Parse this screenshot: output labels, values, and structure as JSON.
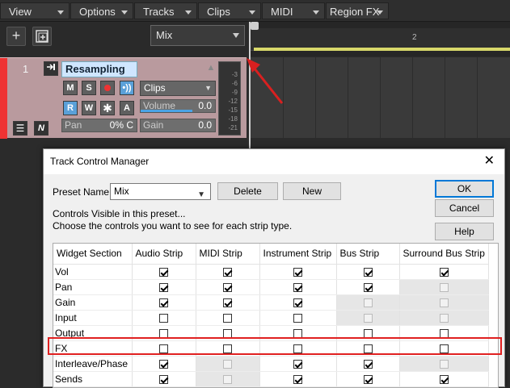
{
  "menubar": {
    "items": [
      "View",
      "Options",
      "Tracks",
      "Clips",
      "MIDI",
      "Region FX"
    ]
  },
  "toolbar": {
    "add_icon": "plus-icon",
    "add_group_icon": "add-group-icon",
    "preset_value": "Mix"
  },
  "ruler": {
    "marker": "2"
  },
  "track": {
    "number": "1",
    "name": "Resampling",
    "buttons": {
      "mute": "M",
      "solo": "S",
      "read": "R",
      "write": "W",
      "automation": "A"
    },
    "clips_dropdown": "Clips",
    "volume_label": "Volume",
    "volume_value": "0.0",
    "volume_level": 0.7,
    "pan_label": "Pan",
    "pan_value": "0% C",
    "gain_label": "Gain",
    "gain_value": "0.0",
    "meter_ticks": [
      "-3",
      "-6",
      "-9",
      "-12",
      "-15",
      "-18",
      "-21"
    ]
  },
  "colors": {
    "track_stripe": "#e33333",
    "highlight": "#e02020",
    "accent": "#0078d7"
  },
  "dialog": {
    "title": "Track Control Manager",
    "preset_label": "Preset Name:",
    "preset_value": "Mix",
    "delete_label": "Delete",
    "new_label": "New",
    "ok_label": "OK",
    "cancel_label": "Cancel",
    "help_label": "Help",
    "info_line1": "Controls Visible in this preset...",
    "info_line2": "Choose the controls you want to see for each strip type.",
    "columns": [
      "Widget Section",
      "Audio Strip",
      "MIDI Strip",
      "Instrument Strip",
      "Bus Strip",
      "Surround Bus Strip"
    ],
    "rows": [
      {
        "name": "Vol",
        "cells": [
          "on",
          "on",
          "on",
          "on",
          "on"
        ]
      },
      {
        "name": "Pan",
        "cells": [
          "on",
          "on",
          "on",
          "on",
          "dis"
        ]
      },
      {
        "name": "Gain",
        "cells": [
          "on",
          "on",
          "on",
          "dis",
          "dis"
        ]
      },
      {
        "name": "Input",
        "cells": [
          "off",
          "off",
          "off",
          "dis",
          "dis"
        ]
      },
      {
        "name": "Output",
        "cells": [
          "off",
          "off",
          "off",
          "off",
          "off"
        ]
      },
      {
        "name": "FX",
        "cells": [
          "off",
          "off",
          "off",
          "off",
          "off"
        ]
      },
      {
        "name": "Interleave/Phase",
        "cells": [
          "on",
          "dis",
          "on",
          "on",
          "dis"
        ]
      },
      {
        "name": "Sends",
        "cells": [
          "on",
          "dis",
          "on",
          "on",
          "on"
        ]
      }
    ]
  }
}
